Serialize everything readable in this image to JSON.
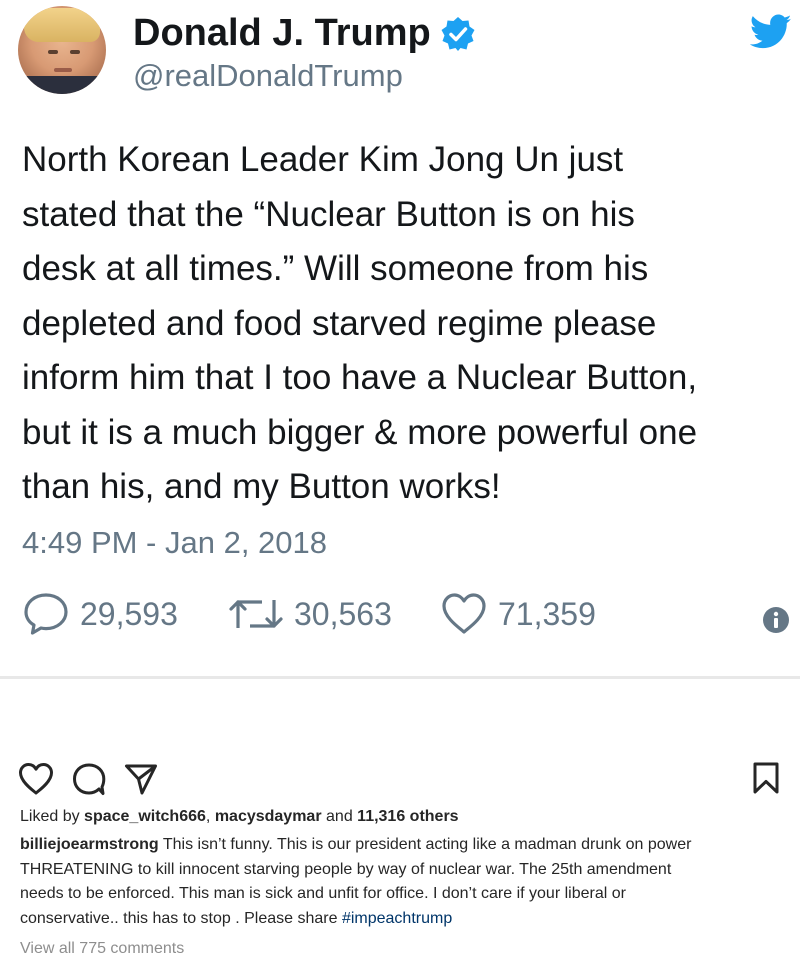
{
  "tweet": {
    "author_name": "Donald J. Trump",
    "handle": "@realDonaldTrump",
    "text_lines": [
      "North Korean Leader Kim Jong Un just",
      "stated that the “Nuclear Button is on his",
      "desk at all times.” Will someone from his",
      "depleted and food starved regime please",
      "inform him that I too have a Nuclear Button,",
      "but it is a much bigger & more powerful one",
      "than his, and my Button works!"
    ],
    "timestamp": "4:49 PM - Jan 2, 2018",
    "replies": "29,593",
    "retweets": "30,563",
    "likes": "71,359",
    "icons": {
      "verified": "verified-badge-icon",
      "brand": "twitter-bird-icon",
      "reply": "reply-icon",
      "retweet": "retweet-icon",
      "like": "heart-icon",
      "info": "info-icon"
    },
    "colors": {
      "brand": "#1da1f2",
      "muted": "#657786",
      "text": "#14171a"
    }
  },
  "instagram": {
    "liked_by_prefix": "Liked by",
    "liked_user_1": "space_witch666",
    "separator": ",",
    "liked_user_2": "macysdaymar",
    "and_word": "and",
    "others_count": "11,316 others",
    "caption_user": "billiejoearmstrong",
    "caption_line_1": "This isn’t funny. This is our president acting like a madman drunk on power",
    "caption_line_2": "THREATENING to kill innocent starving people by way of nuclear war. The 25th amendment",
    "caption_line_3": "needs to be enforced. This man is sick and unfit for office. I don’t care if your liberal or",
    "caption_line_4": "conservative.. this has to stop . Please share",
    "hashtag": "#impeachtrump",
    "view_comments": "View all 775 comments",
    "icons": {
      "like": "heart-outline-icon",
      "comment": "comment-icon",
      "share": "send-icon",
      "save": "bookmark-icon"
    },
    "colors": {
      "hashtag": "#003569",
      "muted": "#8e8e8e"
    }
  }
}
